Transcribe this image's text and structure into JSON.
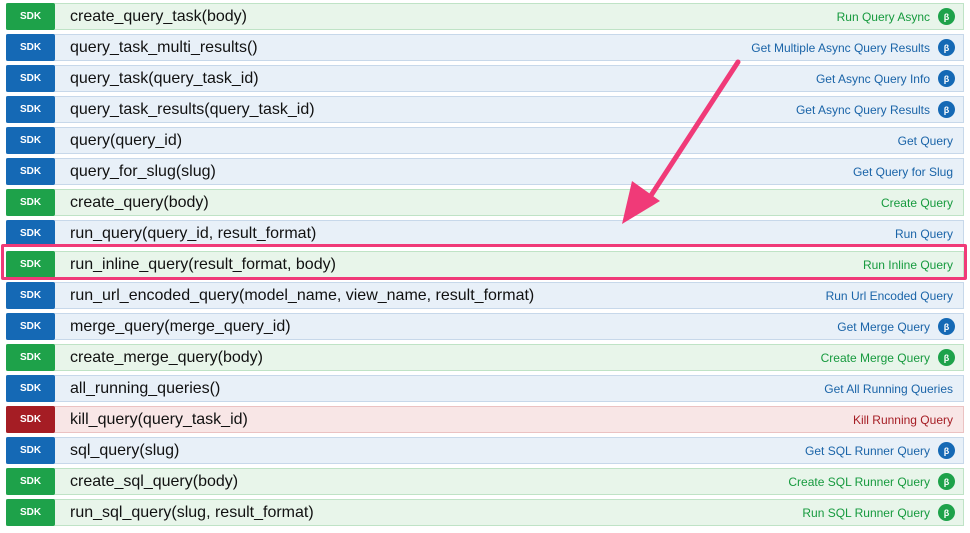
{
  "badge_label": "SDK",
  "beta_symbol": "β",
  "endpoints": [
    {
      "method": "post",
      "signature": "create_query_task(body)",
      "description": "Run Query Async",
      "beta": true
    },
    {
      "method": "get",
      "signature": "query_task_multi_results()",
      "description": "Get Multiple Async Query Results",
      "beta": true
    },
    {
      "method": "get",
      "signature": "query_task(query_task_id)",
      "description": "Get Async Query Info",
      "beta": true
    },
    {
      "method": "get",
      "signature": "query_task_results(query_task_id)",
      "description": "Get Async Query Results",
      "beta": true
    },
    {
      "method": "get",
      "signature": "query(query_id)",
      "description": "Get Query",
      "beta": false
    },
    {
      "method": "get",
      "signature": "query_for_slug(slug)",
      "description": "Get Query for Slug",
      "beta": false
    },
    {
      "method": "post",
      "signature": "create_query(body)",
      "description": "Create Query",
      "beta": false
    },
    {
      "method": "get",
      "signature": "run_query(query_id, result_format)",
      "description": "Run Query",
      "beta": false
    },
    {
      "method": "post",
      "signature": "run_inline_query(result_format, body)",
      "description": "Run Inline Query",
      "beta": false
    },
    {
      "method": "get",
      "signature": "run_url_encoded_query(model_name, view_name, result_format)",
      "description": "Run Url Encoded Query",
      "beta": false
    },
    {
      "method": "get",
      "signature": "merge_query(merge_query_id)",
      "description": "Get Merge Query",
      "beta": true
    },
    {
      "method": "post",
      "signature": "create_merge_query(body)",
      "description": "Create Merge Query",
      "beta": true
    },
    {
      "method": "get",
      "signature": "all_running_queries()",
      "description": "Get All Running Queries",
      "beta": false
    },
    {
      "method": "delete",
      "signature": "kill_query(query_task_id)",
      "description": "Kill Running Query",
      "beta": false
    },
    {
      "method": "get",
      "signature": "sql_query(slug)",
      "description": "Get SQL Runner Query",
      "beta": true
    },
    {
      "method": "post",
      "signature": "create_sql_query(body)",
      "description": "Create SQL Runner Query",
      "beta": true
    },
    {
      "method": "post",
      "signature": "run_sql_query(slug, result_format)",
      "description": "Run SQL Runner Query",
      "beta": true
    }
  ],
  "highlighted_endpoint": "run_inline_query(result_format, body)",
  "colors": {
    "post": "#1ea24a",
    "get": "#1569b5",
    "delete": "#a51d24",
    "annotation": "#f03a78"
  }
}
